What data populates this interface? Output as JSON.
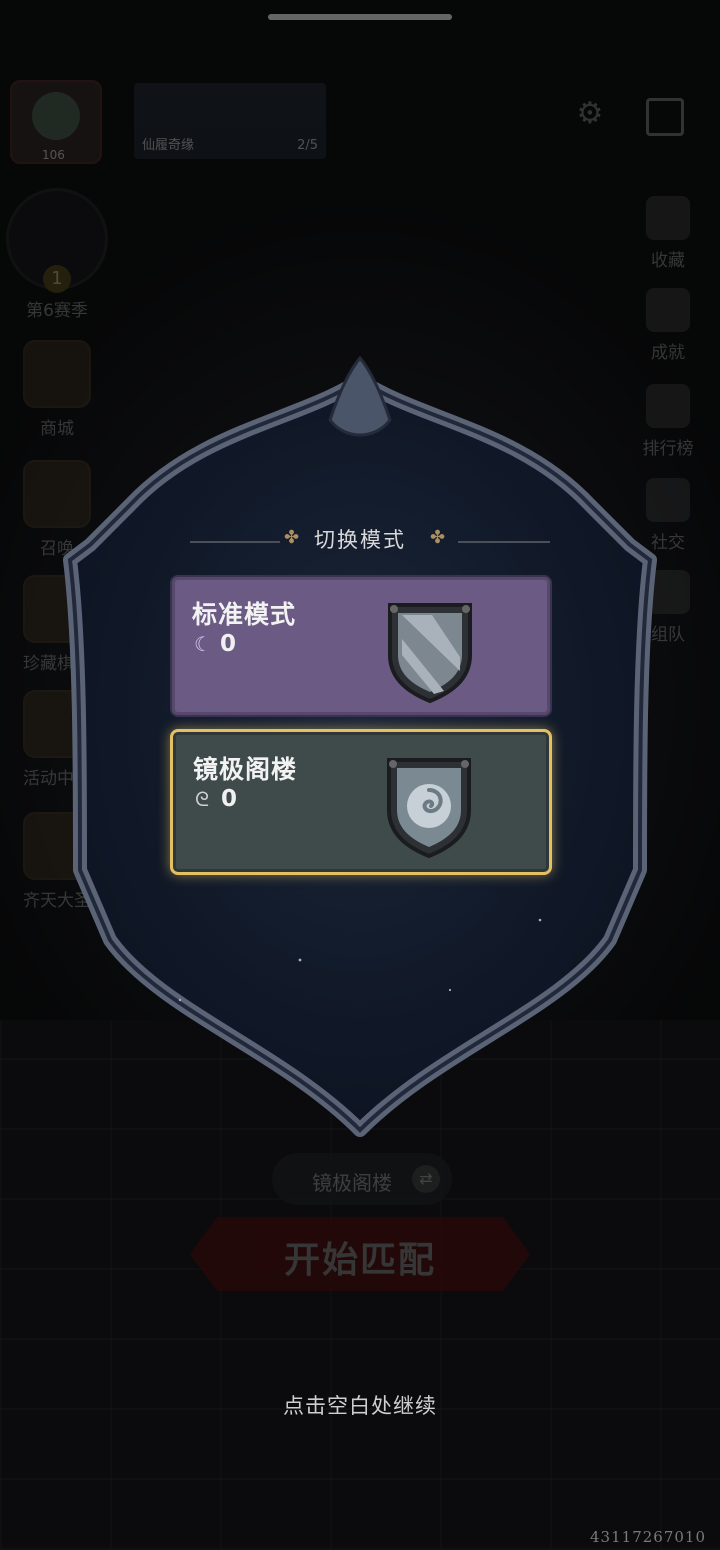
{
  "header": {
    "player_level": "106",
    "banner_title": "仙履奇缘",
    "banner_progress": "2/5"
  },
  "left_sidebar": {
    "season_rank": "1",
    "season_label": "第6赛季",
    "items": [
      {
        "label": "商城",
        "icon": "shop-icon"
      },
      {
        "label": "召唤",
        "icon": "summon-icon"
      },
      {
        "label": "珍藏棋盒",
        "icon": "chess-box-icon"
      },
      {
        "label": "活动中心",
        "icon": "event-icon"
      },
      {
        "label": "齐天大圣",
        "icon": "monkey-king-icon"
      }
    ]
  },
  "right_sidebar": {
    "items": [
      {
        "label": "收藏",
        "icon": "collection-icon"
      },
      {
        "label": "成就",
        "icon": "achievement-icon"
      },
      {
        "label": "排行榜",
        "icon": "leaderboard-icon"
      },
      {
        "label": "社交",
        "icon": "social-icon"
      },
      {
        "label": "组队",
        "icon": "team-icon"
      }
    ]
  },
  "background_controls": {
    "current_mode": "镜极阁楼",
    "start_button": "开始匹配"
  },
  "modal": {
    "title": "切换模式",
    "options": [
      {
        "name": "标准模式",
        "count": "0",
        "currency_icon": "moon-token-icon",
        "selected": false,
        "accent": "#6a5a84"
      },
      {
        "name": "镜极阁楼",
        "count": "0",
        "currency_icon": "swirl-token-icon",
        "selected": true,
        "accent": "#3f4a4b"
      }
    ],
    "selected_border_color": "#e3c062"
  },
  "footer": {
    "continue_hint": "点击空白处继续",
    "uid": "43117267010"
  }
}
